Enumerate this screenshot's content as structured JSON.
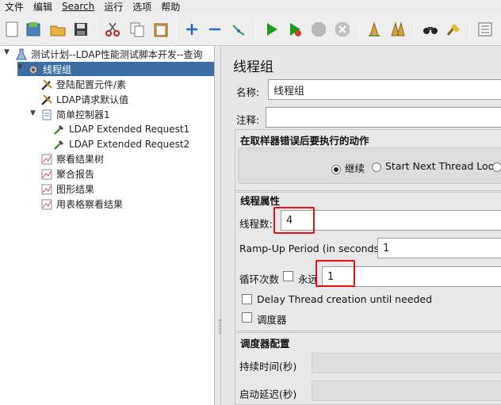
{
  "menu": {
    "file": "文件",
    "edit": "编辑",
    "search": "Search",
    "run": "运行",
    "options": "选项",
    "help": "帮助"
  },
  "toolbar": {
    "icons": [
      "new-icon",
      "templates-icon",
      "open-icon",
      "save-icon",
      "cut-icon",
      "copy-icon",
      "paste-icon",
      "expand-icon",
      "collapse-icon",
      "toggle-icon",
      "start-icon",
      "start-no-pause-icon",
      "stop-icon",
      "shutdown-icon",
      "clear-icon",
      "clear-all-icon",
      "search-icon",
      "reset-search-icon",
      "function-helper-icon"
    ]
  },
  "tree": {
    "root": "测试计划--LDAP性能测试脚本开发--查询",
    "thread_group": "线程组",
    "config": "登陆配置元件/素",
    "ldap_defaults": "LDAP请求默认值",
    "simple_controller": "简单控制器1",
    "request1": "LDAP Extended Request1",
    "request2": "LDAP Extended Request2",
    "view_results_tree": "察看结果树",
    "aggregate_report": "聚合报告",
    "graph_results": "图形结果",
    "table_results": "用表格察看结果"
  },
  "form": {
    "title": "线程组",
    "name_label": "名称:",
    "name_value": "线程组",
    "comment_label": "注释:",
    "comment_value": "",
    "error_section": "在取样器错误后要执行的动作",
    "opt_continue": "继续",
    "opt_start_next": "Start Next Thread Loop",
    "thread_props": "线程属性",
    "threads_label": "线程数:",
    "threads_value": "4",
    "rampup_label": "Ramp-Up Period (in seconds):",
    "rampup_value": "1",
    "loop_label": "循环次数",
    "forever_label": "永远",
    "loop_value": "1",
    "delay_label": "Delay Thread creation until needed",
    "scheduler_label": "调度器",
    "scheduler_config": "调度器配置",
    "duration_label": "持续时间(秒)",
    "startup_delay_label": "启动延迟(秒)"
  },
  "colors": {
    "selection": "#3a6ea5",
    "highlight": "#e01414",
    "run_green": "#1a9e1a"
  }
}
